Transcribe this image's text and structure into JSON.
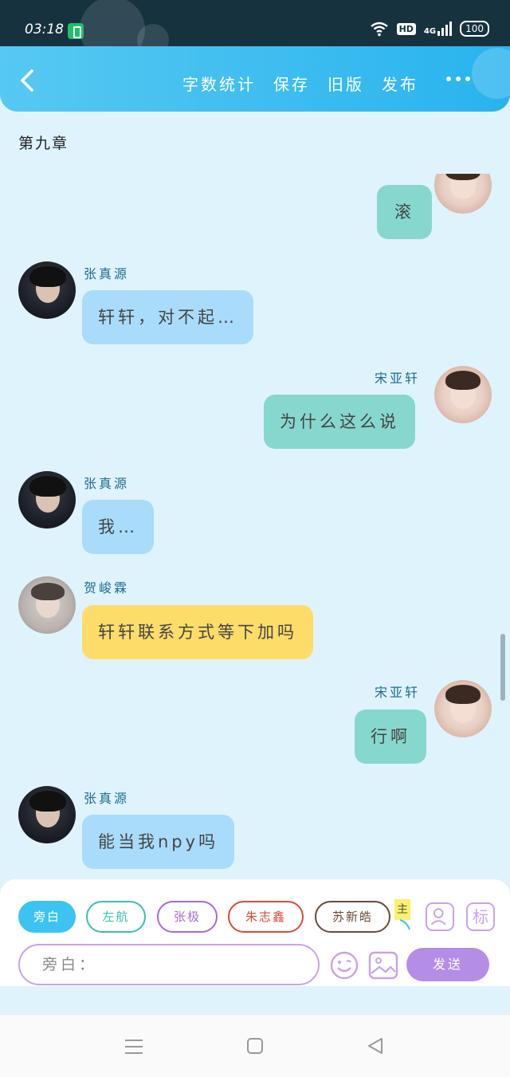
{
  "status_bar": {
    "time": "03:18",
    "hd": "HD",
    "network": "4G",
    "battery": "100"
  },
  "header": {
    "actions": [
      "字数统计",
      "保存",
      "旧版",
      "发布"
    ]
  },
  "chapter_title": "第九章",
  "messages": [
    {
      "side": "right",
      "avatar": "song-yaxuan-avatar",
      "name": "",
      "text": "滚",
      "color": "#86d8cf"
    },
    {
      "side": "left",
      "avatar": "zhang-zhenyuan-avatar",
      "name": "张真源",
      "text": "轩轩，对不起…",
      "color": "#a9dcfb"
    },
    {
      "side": "right",
      "avatar": "song-yaxuan-avatar",
      "name": "宋亚轩",
      "text": "为什么这么说",
      "color": "#86d8cf"
    },
    {
      "side": "left",
      "avatar": "zhang-zhenyuan-avatar",
      "name": "张真源",
      "text": "我…",
      "color": "#a9dcfb"
    },
    {
      "side": "left",
      "avatar": "he-junlin-avatar",
      "name": "贺峻霖",
      "text": "轩轩联系方式等下加吗",
      "color": "#fddc6a"
    },
    {
      "side": "right",
      "avatar": "song-yaxuan-avatar",
      "name": "宋亚轩",
      "text": "行啊",
      "color": "#86d8cf"
    },
    {
      "side": "left",
      "avatar": "zhang-zhenyuan-avatar",
      "name": "张真源",
      "text": "能当我npy吗",
      "color": "#a9dcfb"
    }
  ],
  "character_chips": [
    {
      "label": "旁白",
      "color": "#3cc3f2",
      "active": true
    },
    {
      "label": "左航",
      "color": "#3cbfb0",
      "active": false
    },
    {
      "label": "张极",
      "color": "#a86ad6",
      "active": false
    },
    {
      "label": "朱志鑫",
      "color": "#d94a3a",
      "active": false
    },
    {
      "label": "苏新皓",
      "color": "#6b4a3a",
      "active": false
    }
  ],
  "main_tag": "主",
  "icon_labels": {
    "mark": "标"
  },
  "input": {
    "placeholder": "旁白："
  },
  "send_label": "发送"
}
